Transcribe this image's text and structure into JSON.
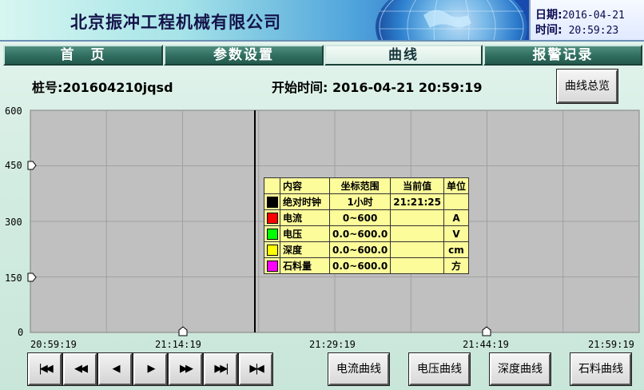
{
  "header": {
    "company_name": "北京振冲工程机械有限公司",
    "date_label": "日期:",
    "date_value": "2016-04-21",
    "time_label": "时间:",
    "time_value": "20:59:23"
  },
  "nav": {
    "tabs": [
      {
        "label": "首　页",
        "active": false
      },
      {
        "label": "参数设置",
        "active": false
      },
      {
        "label": "曲线",
        "active": true
      },
      {
        "label": "报警记录",
        "active": false
      }
    ]
  },
  "info": {
    "pile_label": "桩号:",
    "pile_value": "201604210jqsd",
    "start_label": "开始时间:",
    "start_value": "2016-04-21 20:59:19",
    "overview_button": "曲线总览"
  },
  "chart_data": {
    "type": "line",
    "ylim": [
      0,
      600
    ],
    "yticks": [
      "600",
      "450",
      "300",
      "150",
      "0"
    ],
    "xticks": [
      "20:59:19",
      "21:14:19",
      "21:29:19",
      "21:44:19",
      "21:59:19"
    ],
    "series": [],
    "grid": true,
    "background": "#c0c0c0"
  },
  "legend": {
    "headers": [
      "内容",
      "坐标范围",
      "当前值",
      "单位"
    ],
    "rows": [
      {
        "color": "#000000",
        "name": "绝对时钟",
        "range": "1小时",
        "current": "21:21:25",
        "unit": ""
      },
      {
        "color": "#ff0000",
        "name": "电流",
        "range": "0~600",
        "current": "",
        "unit": "A"
      },
      {
        "color": "#00ff00",
        "name": "电压",
        "range": "0.0~600.0",
        "current": "",
        "unit": "V"
      },
      {
        "color": "#ffff00",
        "name": "深度",
        "range": "0.0~600.0",
        "current": "",
        "unit": "cm"
      },
      {
        "color": "#ff00ff",
        "name": "石料量",
        "range": "0.0~600.0",
        "current": "",
        "unit": "方"
      }
    ]
  },
  "controls": {
    "nav_buttons": [
      {
        "name": "first-page-button",
        "glyph": "|◀◀"
      },
      {
        "name": "fast-backward-button",
        "glyph": "◀◀"
      },
      {
        "name": "step-backward-button",
        "glyph": "◀"
      },
      {
        "name": "step-forward-button",
        "glyph": "▶"
      },
      {
        "name": "fast-forward-button",
        "glyph": "▶▶"
      },
      {
        "name": "last-page-button",
        "glyph": "▶▶|"
      },
      {
        "name": "latest-button",
        "glyph": "▶|◀"
      }
    ],
    "curve_buttons": [
      "电流曲线",
      "电压曲线",
      "深度曲线",
      "石料曲线"
    ]
  }
}
